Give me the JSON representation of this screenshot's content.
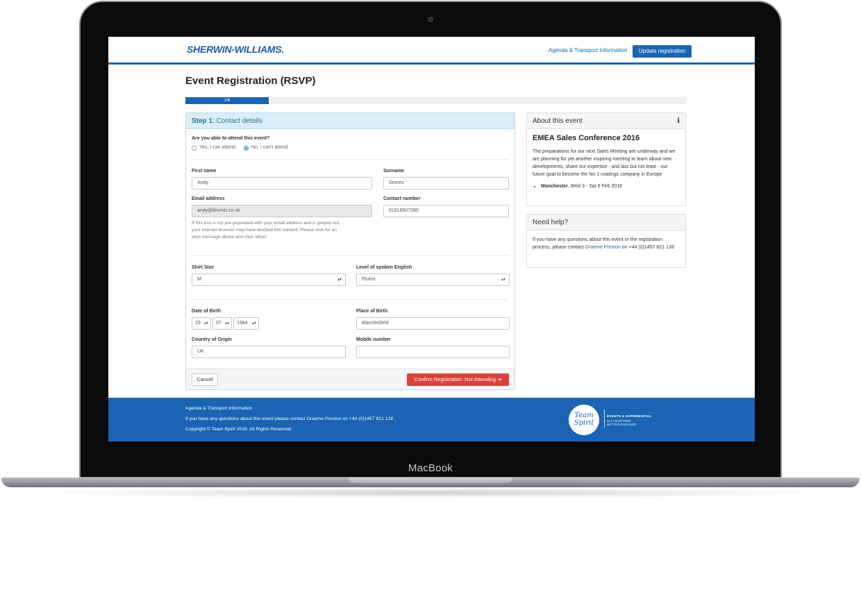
{
  "laptop": {
    "brand_label": "MacBook"
  },
  "header": {
    "logo_text": "SHERWIN-WILLIAMS.",
    "nav_link": "Agenda & Transport Information",
    "update_button": "Update registration"
  },
  "page": {
    "title": "Event Registration (RSVP)",
    "progress_label": "1/6",
    "progress_fraction": 0.1667
  },
  "step": {
    "prefix": "Step 1",
    "suffix": ": Contact details"
  },
  "form": {
    "attend_question": "Are you able to attend this event?",
    "attend_yes": "Yes, I can attend",
    "attend_no": "No, I can't attend",
    "attend_selected": "no",
    "first_name_label": "First name",
    "first_name_value": "Andy",
    "surname_label": "Surname",
    "surname_value": "Stones",
    "email_label": "Email address",
    "email_value": "andy@blumin.co.uk",
    "email_help_1": "If this box is not pre-populated with your email address and is greyed out,",
    "email_help_2": "your internet browser may have blocked this content. Please look for an",
    "email_help_3": "alert message above and click 'allow'.",
    "contact_label": "Contact number",
    "contact_value": "01618507090",
    "shirt_label": "Shirt Size",
    "shirt_value": "M",
    "english_label": "Level of spoken English",
    "english_value": "Fluent",
    "dob_label": "Date of Birth",
    "dob_day": "29",
    "dob_month": "07",
    "dob_year": "1984",
    "pob_label": "Place of Birth",
    "pob_value": "Macclesfield",
    "country_label": "Country of Origin",
    "country_value": "UK",
    "mobile_label": "Mobile number",
    "mobile_value": ""
  },
  "actions": {
    "cancel": "Cancel",
    "confirm": "Confirm Registration: Not Attending ➔"
  },
  "about": {
    "heading": "About this event",
    "info_icon": "i",
    "event_title": "EMEA Sales Conference 2016",
    "description": "The preparations for our next Sales Meeting are underway and we are planning for yet another inspiring meeting to learn about new developments, share our expertise - and last but not least - our future goal to become the No 1 coatings company in Europe",
    "location_city": "Manchester",
    "location_dates": ", Wed 3 - Sat 6 Feb 2016"
  },
  "help": {
    "heading": "Need help?",
    "text_before": "If you have any questions about this event or the registration process, please contact ",
    "contact_name": "Graeme Preston",
    "text_after": " on +44 (0)1457 821 128"
  },
  "footer": {
    "line1": "Agenda & Transport Information",
    "line2": "If you have any questions about this event please contact Graeme Preston  on +44 (0)1457 821 128 .",
    "line3": "Copyright © Team Spirit 2016. All Rights Reserved.",
    "logo_text_1": "Team",
    "logo_text_2": "Spirit",
    "tag1": "EVENTS & EXPERIENTIAL",
    "tag2": "ALL TOGETHER",
    "tag3": "BETTER ENGAGED"
  }
}
